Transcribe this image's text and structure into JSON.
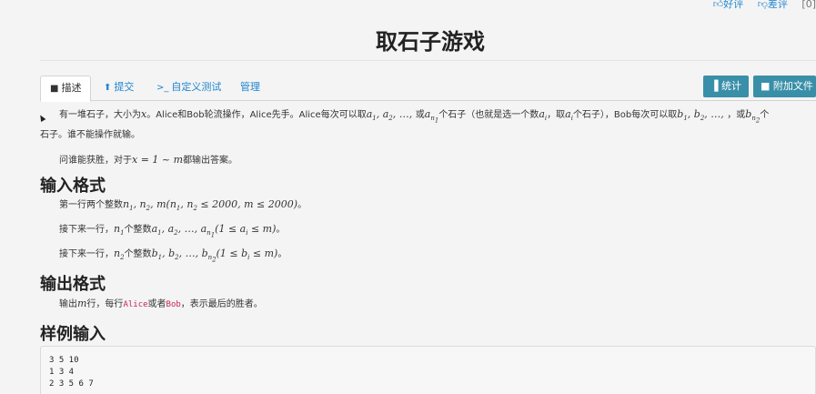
{
  "topbar": {
    "like": "好评",
    "dislike": "差评",
    "count": "[0]"
  },
  "title": "取石子游戏",
  "tabs": [
    {
      "label": "描述",
      "icon": "file-icon"
    },
    {
      "label": "提交",
      "icon": "upload-icon"
    },
    {
      "label": "自定义测试",
      "icon": "terminal-icon"
    },
    {
      "label": "管理",
      "icon": ""
    }
  ],
  "buttons": {
    "stats": "统计",
    "attachments": "附加文件"
  },
  "description": {
    "line1_a": "有一堆石子，大小为",
    "line1_b": "。Alice和Bob轮流操作，Alice先手。Alice每次可以取",
    "line1_c": "个石子（也就是选一个数",
    "line1_d": "，取",
    "line1_e": "个石子），Bob每次可以取",
    "line1_f": "，或",
    "line2": "石子。谁不能操作就输。",
    "line3_a": "问谁能获胜，对于",
    "line3_b": "都输出答案。"
  },
  "input_format": {
    "heading": "输入格式",
    "l1_a": "第一行两个整数",
    "l1_b": "。",
    "l2_a": "接下来一行，",
    "l2_b": "个整数",
    "l2_c": "。",
    "l3_a": "接下来一行，",
    "l3_b": "个整数",
    "l3_c": "。"
  },
  "output_format": {
    "heading": "输出格式",
    "a": "输出",
    "b": "行，每行",
    "alice": "Alice",
    "c": "或者",
    "bob": "Bob",
    "d": "，表示最后的胜者。"
  },
  "sample_input": {
    "heading": "样例输入",
    "lines": [
      "3 5 10",
      "1 3 4",
      "2 3 5 6 7"
    ]
  }
}
